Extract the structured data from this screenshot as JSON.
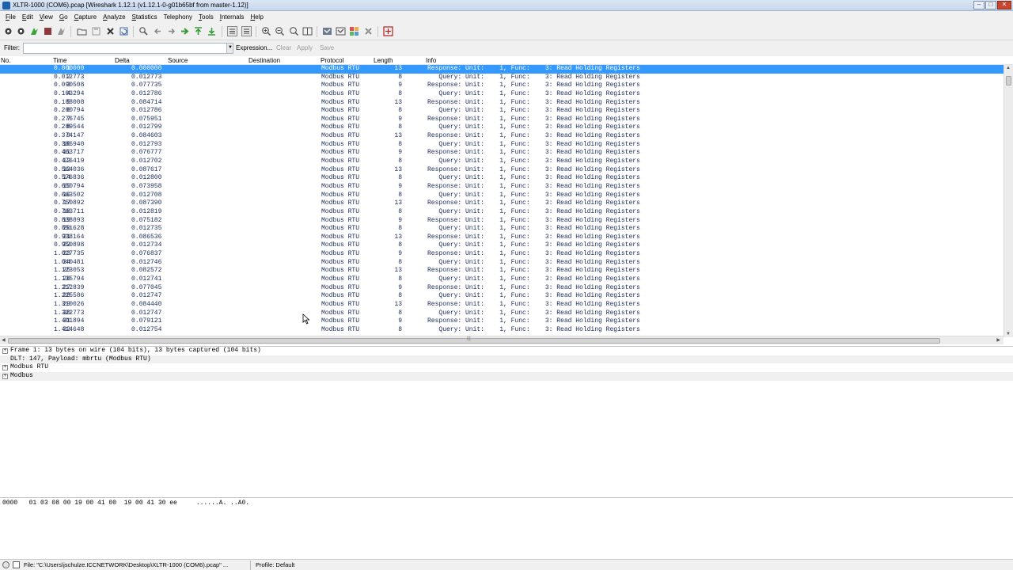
{
  "window": {
    "title": "XLTR-1000 (COM6).pcap   [Wireshark 1.12.1  (v1.12.1-0-g01b65bf from master-1.12)]",
    "controls": {
      "minimize": "–",
      "maximize": "□",
      "close": "✕"
    }
  },
  "menu": [
    {
      "u": "F",
      "rest": "ile"
    },
    {
      "u": "E",
      "rest": "dit"
    },
    {
      "u": "V",
      "rest": "iew"
    },
    {
      "u": "G",
      "rest": "o"
    },
    {
      "u": "C",
      "rest": "apture"
    },
    {
      "u": "A",
      "rest": "nalyze"
    },
    {
      "u": "S",
      "rest": "tatistics"
    },
    {
      "u": "",
      "rest": "Telephony"
    },
    {
      "u": "T",
      "rest": "ools"
    },
    {
      "u": "I",
      "rest": "nternals"
    },
    {
      "u": "H",
      "rest": "elp"
    }
  ],
  "toolbar_icons": [
    "interface-list-icon",
    "capture-options-icon",
    "start-capture-icon",
    "stop-capture-icon",
    "restart-capture-icon",
    "open-file-icon",
    "save-file-icon",
    "close-file-icon",
    "reload-icon",
    "find-packet-icon",
    "go-back-icon",
    "go-forward-icon",
    "go-to-packet-icon",
    "go-first-icon",
    "go-last-icon",
    "colorize-icon",
    "autoscroll-icon",
    "zoom-in-icon",
    "zoom-out-icon",
    "normal-size-icon",
    "resize-columns-icon",
    "capture-filters-icon",
    "display-filters-icon",
    "coloring-rules-icon",
    "preferences-icon",
    "help-icon"
  ],
  "filter": {
    "label": "Filter:",
    "value": "",
    "expression": "Expression...",
    "clear": "Clear",
    "apply": "Apply",
    "save": "Save"
  },
  "columns": {
    "no": "No.",
    "time": "Time",
    "delta": "Delta",
    "source": "Source",
    "destination": "Destination",
    "protocol": "Protocol",
    "length": "Length",
    "info": "Info"
  },
  "packets": [
    {
      "no": "1",
      "time": "0.000000",
      "delta": "0.000000",
      "proto": "Modbus RTU",
      "len": "13",
      "info": "Response: Unit:    1, Func:    3: Read Holding Registers"
    },
    {
      "no": "2",
      "time": "0.012773",
      "delta": "0.012773",
      "proto": "Modbus RTU",
      "len": "8",
      "info": "   Query: Unit:    1, Func:    3: Read Holding Registers"
    },
    {
      "no": "3",
      "time": "0.090508",
      "delta": "0.077735",
      "proto": "Modbus RTU",
      "len": "9",
      "info": "Response: Unit:    1, Func:    3: Read Holding Registers"
    },
    {
      "no": "4",
      "time": "0.103294",
      "delta": "0.012786",
      "proto": "Modbus RTU",
      "len": "8",
      "info": "   Query: Unit:    1, Func:    3: Read Holding Registers"
    },
    {
      "no": "5",
      "time": "0.188008",
      "delta": "0.084714",
      "proto": "Modbus RTU",
      "len": "13",
      "info": "Response: Unit:    1, Func:    3: Read Holding Registers"
    },
    {
      "no": "6",
      "time": "0.200794",
      "delta": "0.012786",
      "proto": "Modbus RTU",
      "len": "8",
      "info": "   Query: Unit:    1, Func:    3: Read Holding Registers"
    },
    {
      "no": "7",
      "time": "0.276745",
      "delta": "0.075951",
      "proto": "Modbus RTU",
      "len": "9",
      "info": "Response: Unit:    1, Func:    3: Read Holding Registers"
    },
    {
      "no": "8",
      "time": "0.289544",
      "delta": "0.012799",
      "proto": "Modbus RTU",
      "len": "8",
      "info": "   Query: Unit:    1, Func:    3: Read Holding Registers"
    },
    {
      "no": "9",
      "time": "0.374147",
      "delta": "0.084603",
      "proto": "Modbus RTU",
      "len": "13",
      "info": "Response: Unit:    1, Func:    3: Read Holding Registers"
    },
    {
      "no": "10",
      "time": "0.386940",
      "delta": "0.012793",
      "proto": "Modbus RTU",
      "len": "8",
      "info": "   Query: Unit:    1, Func:    3: Read Holding Registers"
    },
    {
      "no": "11",
      "time": "0.463717",
      "delta": "0.076777",
      "proto": "Modbus RTU",
      "len": "9",
      "info": "Response: Unit:    1, Func:    3: Read Holding Registers"
    },
    {
      "no": "12",
      "time": "0.476419",
      "delta": "0.012702",
      "proto": "Modbus RTU",
      "len": "8",
      "info": "   Query: Unit:    1, Func:    3: Read Holding Registers"
    },
    {
      "no": "13",
      "time": "0.564036",
      "delta": "0.087617",
      "proto": "Modbus RTU",
      "len": "13",
      "info": "Response: Unit:    1, Func:    3: Read Holding Registers"
    },
    {
      "no": "14",
      "time": "0.576836",
      "delta": "0.012800",
      "proto": "Modbus RTU",
      "len": "8",
      "info": "   Query: Unit:    1, Func:    3: Read Holding Registers"
    },
    {
      "no": "15",
      "time": "0.650794",
      "delta": "0.073958",
      "proto": "Modbus RTU",
      "len": "9",
      "info": "Response: Unit:    1, Func:    3: Read Holding Registers"
    },
    {
      "no": "16",
      "time": "0.663502",
      "delta": "0.012708",
      "proto": "Modbus RTU",
      "len": "8",
      "info": "   Query: Unit:    1, Func:    3: Read Holding Registers"
    },
    {
      "no": "17",
      "time": "0.750892",
      "delta": "0.087390",
      "proto": "Modbus RTU",
      "len": "13",
      "info": "Response: Unit:    1, Func:    3: Read Holding Registers"
    },
    {
      "no": "18",
      "time": "0.763711",
      "delta": "0.012819",
      "proto": "Modbus RTU",
      "len": "8",
      "info": "   Query: Unit:    1, Func:    3: Read Holding Registers"
    },
    {
      "no": "19",
      "time": "0.838893",
      "delta": "0.075182",
      "proto": "Modbus RTU",
      "len": "9",
      "info": "Response: Unit:    1, Func:    3: Read Holding Registers"
    },
    {
      "no": "20",
      "time": "0.851628",
      "delta": "0.012735",
      "proto": "Modbus RTU",
      "len": "8",
      "info": "   Query: Unit:    1, Func:    3: Read Holding Registers"
    },
    {
      "no": "21",
      "time": "0.938164",
      "delta": "0.086536",
      "proto": "Modbus RTU",
      "len": "13",
      "info": "Response: Unit:    1, Func:    3: Read Holding Registers"
    },
    {
      "no": "22",
      "time": "0.950898",
      "delta": "0.012734",
      "proto": "Modbus RTU",
      "len": "8",
      "info": "   Query: Unit:    1, Func:    3: Read Holding Registers"
    },
    {
      "no": "23",
      "time": "1.027735",
      "delta": "0.076837",
      "proto": "Modbus RTU",
      "len": "9",
      "info": "Response: Unit:    1, Func:    3: Read Holding Registers"
    },
    {
      "no": "24",
      "time": "1.040481",
      "delta": "0.012746",
      "proto": "Modbus RTU",
      "len": "8",
      "info": "   Query: Unit:    1, Func:    3: Read Holding Registers"
    },
    {
      "no": "25",
      "time": "1.123053",
      "delta": "0.082572",
      "proto": "Modbus RTU",
      "len": "13",
      "info": "Response: Unit:    1, Func:    3: Read Holding Registers"
    },
    {
      "no": "26",
      "time": "1.135794",
      "delta": "0.012741",
      "proto": "Modbus RTU",
      "len": "8",
      "info": "   Query: Unit:    1, Func:    3: Read Holding Registers"
    },
    {
      "no": "27",
      "time": "1.212839",
      "delta": "0.077045",
      "proto": "Modbus RTU",
      "len": "9",
      "info": "Response: Unit:    1, Func:    3: Read Holding Registers"
    },
    {
      "no": "28",
      "time": "1.225586",
      "delta": "0.012747",
      "proto": "Modbus RTU",
      "len": "8",
      "info": "   Query: Unit:    1, Func:    3: Read Holding Registers"
    },
    {
      "no": "29",
      "time": "1.310026",
      "delta": "0.084440",
      "proto": "Modbus RTU",
      "len": "13",
      "info": "Response: Unit:    1, Func:    3: Read Holding Registers"
    },
    {
      "no": "30",
      "time": "1.322773",
      "delta": "0.012747",
      "proto": "Modbus RTU",
      "len": "8",
      "info": "   Query: Unit:    1, Func:    3: Read Holding Registers"
    },
    {
      "no": "31",
      "time": "1.401894",
      "delta": "0.079121",
      "proto": "Modbus RTU",
      "len": "9",
      "info": "Response: Unit:    1, Func:    3: Read Holding Registers"
    },
    {
      "no": "32",
      "time": "1.414648",
      "delta": "0.012754",
      "proto": "Modbus RTU",
      "len": "8",
      "info": "   Query: Unit:    1, Func:    3: Read Holding Registers"
    }
  ],
  "selected_packet_index": 0,
  "details": [
    {
      "expandable": true,
      "text": "Frame 1: 13 bytes on wire (104 bits), 13 bytes captured (104 bits)"
    },
    {
      "expandable": false,
      "text": "DLT: 147, Payload: mbrtu (Modbus RTU)"
    },
    {
      "expandable": true,
      "text": "Modbus RTU"
    },
    {
      "expandable": true,
      "text": "Modbus"
    }
  ],
  "hex": {
    "offset": "0000",
    "bytes": "01 03 08 00 19 00 41 00  19 00 41 30 ee",
    "ascii": "......A. ..A0."
  },
  "status": {
    "file": "File: \"C:\\Users\\jschulze.ICCNETWORK\\Desktop\\XLTR-1000 (COM6).pcap\" ...",
    "ellipsis": "...",
    "profile": "Profile: Default"
  },
  "colors": {
    "selection": "#3399ff",
    "row_text": "#1a2a5a",
    "menubar": "#f0f0f0"
  }
}
